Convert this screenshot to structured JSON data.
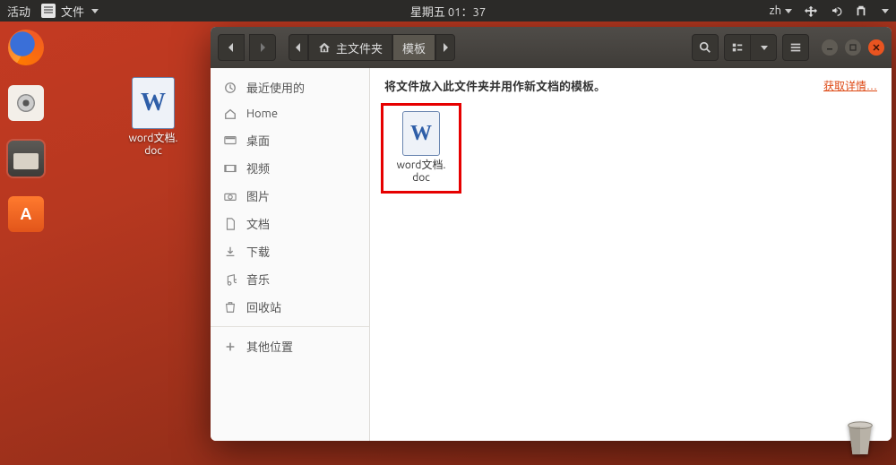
{
  "panel": {
    "activities": "活动",
    "app_menu": "文件",
    "clock": "星期五 01：37",
    "input_method": "zh"
  },
  "desktop": {
    "file": {
      "name_line1": "word文档.",
      "name_line2": "doc"
    }
  },
  "window": {
    "path": {
      "home_label": "主文件夹",
      "current": "模板"
    },
    "infobar": {
      "message": "将文件放入此文件夹并用作新文档的模板。",
      "link": "获取详情…"
    },
    "file": {
      "name_line1": "word文档.",
      "name_line2": "doc"
    }
  },
  "sidebar": {
    "recent": "最近使用的",
    "home": "Home",
    "desktop": "桌面",
    "videos": "视频",
    "pictures": "图片",
    "documents": "文档",
    "downloads": "下载",
    "music": "音乐",
    "trash": "回收站",
    "other": "其他位置"
  }
}
